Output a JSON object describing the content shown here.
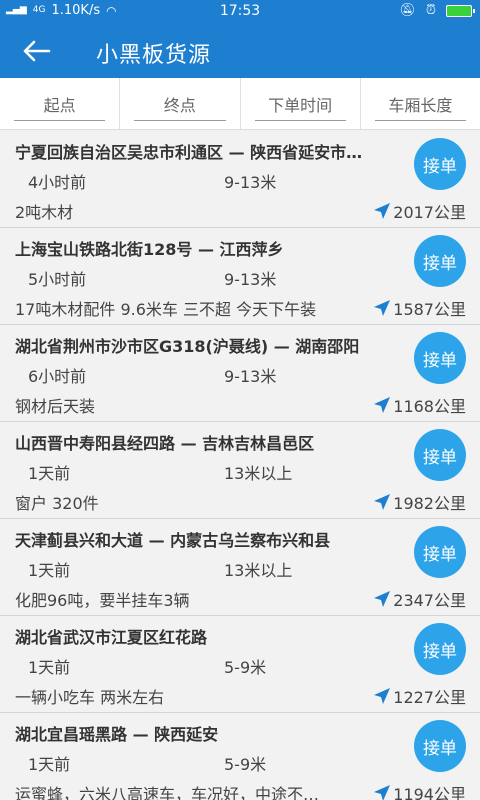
{
  "status": {
    "network": "4G",
    "speed": "1.10K/s",
    "time": "17:53"
  },
  "header": {
    "title": "小黑板货源"
  },
  "tabs": [
    {
      "label": "起点"
    },
    {
      "label": "终点"
    },
    {
      "label": "下单时间"
    },
    {
      "label": "车厢长度"
    }
  ],
  "accept_label": "接单",
  "items": [
    {
      "route": "宁夏回族自治区吴忠市利通区 — 陕西省延安市…",
      "time": "4小时前",
      "length": "9-13米",
      "desc": "2吨木材",
      "distance": "2017公里"
    },
    {
      "route": "上海宝山铁路北街128号 — 江西萍乡",
      "time": "5小时前",
      "length": "9-13米",
      "desc": "17吨木材配件 9.6米车 三不超 今天下午装",
      "distance": "1587公里"
    },
    {
      "route": "湖北省荆州市沙市区G318(沪聂线) — 湖南邵阳",
      "time": "6小时前",
      "length": "9-13米",
      "desc": "钢材后天装",
      "distance": "1168公里"
    },
    {
      "route": "山西晋中寿阳县经四路 — 吉林吉林昌邑区",
      "time": "1天前",
      "length": "13米以上",
      "desc": "窗户 320件",
      "distance": "1982公里"
    },
    {
      "route": "天津蓟县兴和大道 — 内蒙古乌兰察布兴和县",
      "time": "1天前",
      "length": "13米以上",
      "desc": "化肥96吨，要半挂车3辆",
      "distance": "2347公里"
    },
    {
      "route": "湖北省武汉市江夏区红花路",
      "time": "1天前",
      "length": "5-9米",
      "desc": "一辆小吃车  两米左右",
      "distance": "1227公里"
    },
    {
      "route": "湖北宜昌瑶黑路 — 陕西延安",
      "time": "1天前",
      "length": "5-9米",
      "desc": "运蜜蜂，六米八高速车，车况好，中途不…",
      "distance": "1194公里"
    }
  ]
}
